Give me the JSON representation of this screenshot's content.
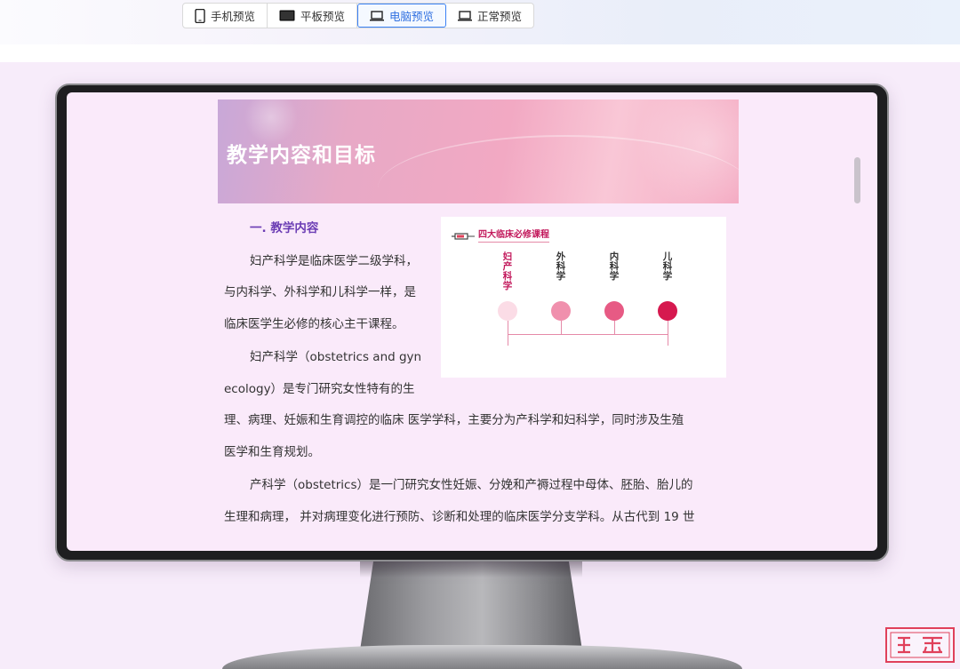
{
  "toolbar": {
    "buttons": [
      {
        "label": "手机预览",
        "icon": "phone-icon",
        "active": false
      },
      {
        "label": "平板预览",
        "icon": "tablet-icon",
        "active": false
      },
      {
        "label": "电脑预览",
        "icon": "laptop-icon",
        "active": true
      },
      {
        "label": "正常预览",
        "icon": "laptop-icon",
        "active": false
      }
    ]
  },
  "document": {
    "banner_title": "教学内容和目标",
    "section_heading": "一. 教学内容",
    "lines": [
      "妇产科学是临床医学二级学科，",
      "与内科学、外科学和儿科学一样，是",
      "临床医学生必修的核心主干课程。",
      "妇产科学（obstetrics and gyn",
      "ecology）是专门研究女性特有的生",
      "理、病理、妊娠和生育调控的临床 医学学科，主要分为产科学和妇科学，同时涉及生殖",
      "医学和生育规划。",
      "产科学（obstetrics）是一门研究女性妊娠、分娩和产褥过程中母体、胚胎、胎儿的",
      "生理和病理， 并对病理变化进行预防、诊断和处理的临床医学分支学科。从古代到 19 世"
    ]
  },
  "figure": {
    "title": "四大临床必修课程",
    "items": [
      {
        "label": "妇产科学",
        "color": "#fbdce6"
      },
      {
        "label": "外科学",
        "color": "#f090ad"
      },
      {
        "label": "内科学",
        "color": "#e75a84"
      },
      {
        "label": "儿科学",
        "color": "#d6194f"
      }
    ]
  },
  "colors": {
    "active_tab": "#3b82f6",
    "heading": "#6b3db4",
    "accent": "#c2185b"
  }
}
